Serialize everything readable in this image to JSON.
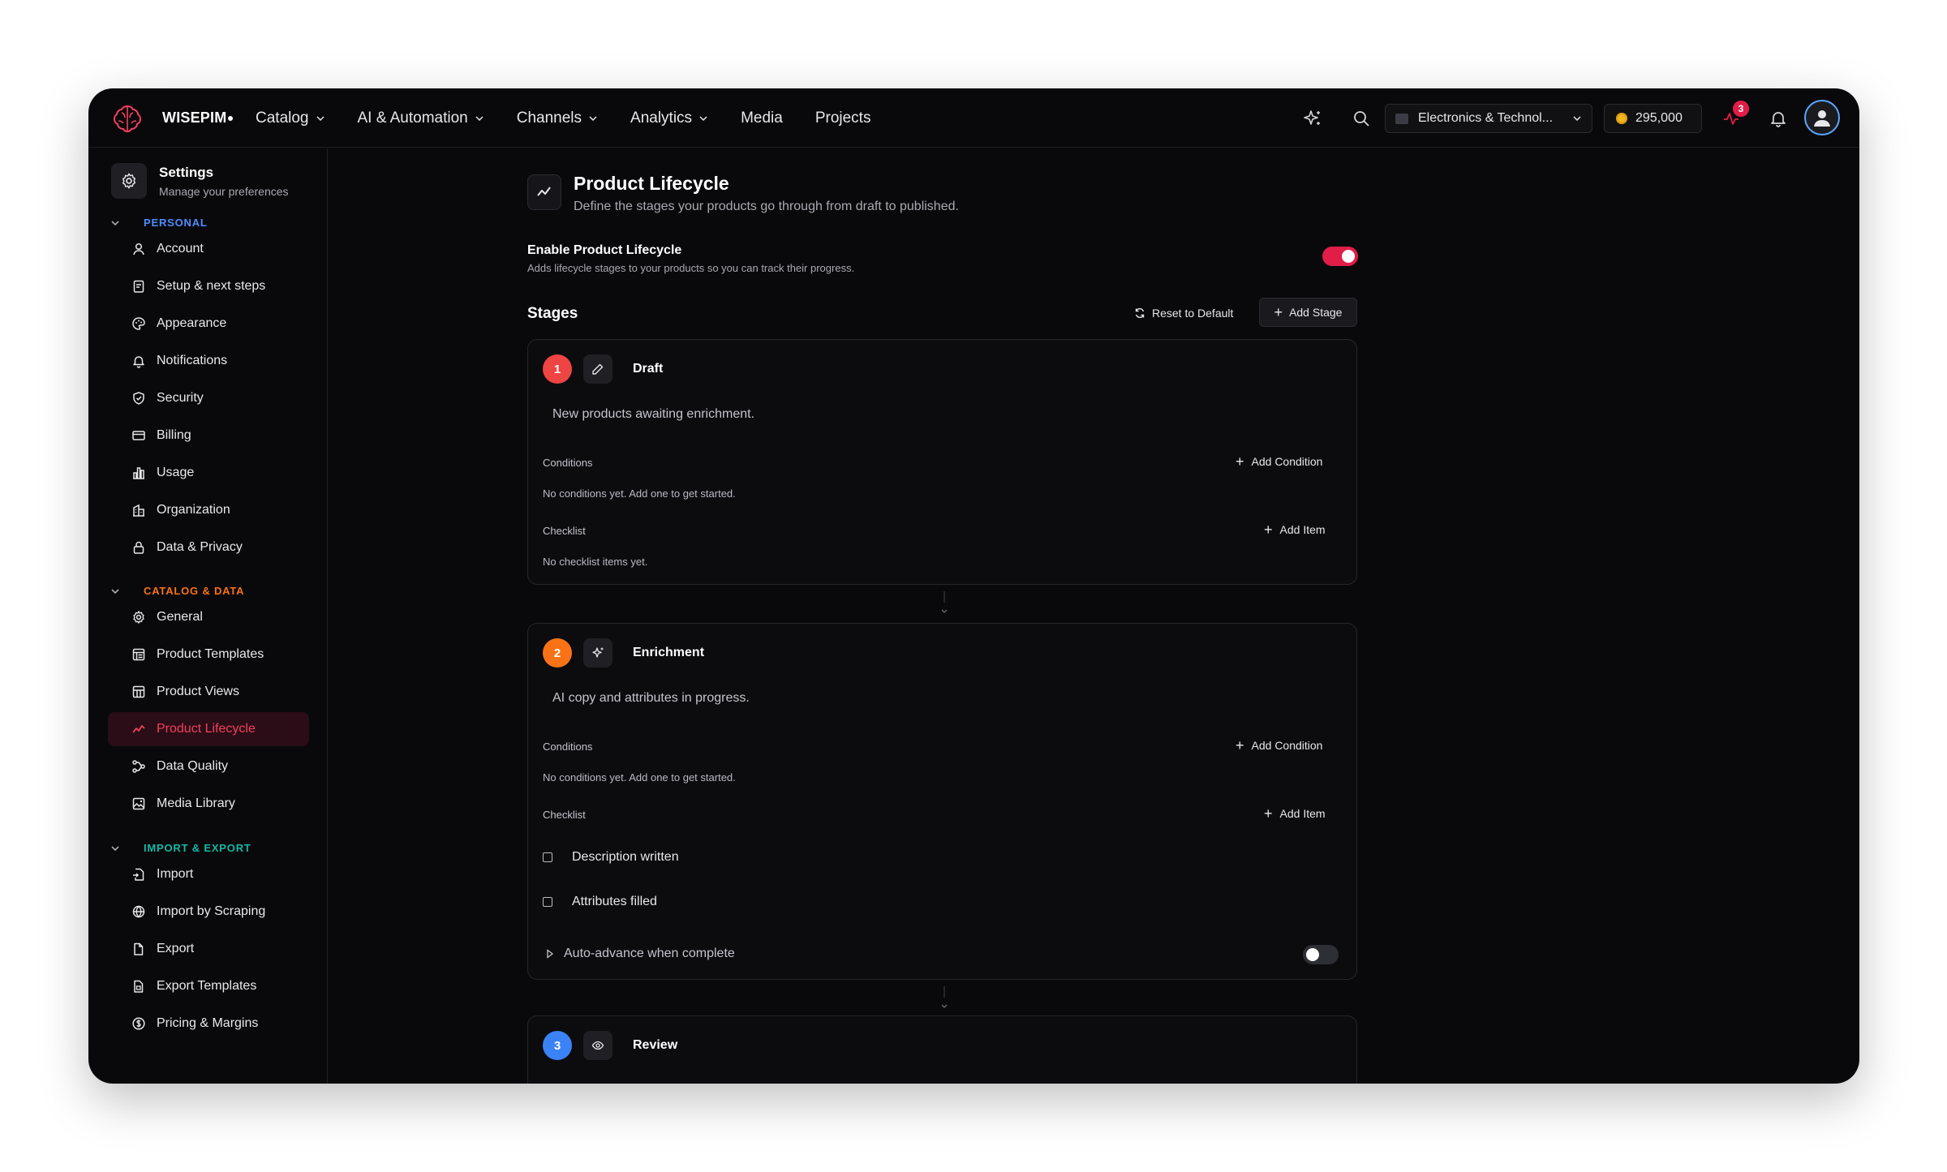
{
  "brand": {
    "name": "WISEPIM"
  },
  "nav": {
    "items": [
      {
        "label": "Catalog",
        "dropdown": true
      },
      {
        "label": "AI & Automation",
        "dropdown": true
      },
      {
        "label": "Channels",
        "dropdown": true
      },
      {
        "label": "Analytics",
        "dropdown": true
      },
      {
        "label": "Media",
        "dropdown": false
      },
      {
        "label": "Projects",
        "dropdown": false
      }
    ]
  },
  "topbar": {
    "org": "Electronics & Technol...",
    "credits": "295,000",
    "notification_badge": "3",
    "icons": [
      "sparkles-icon",
      "search-icon",
      "activity-icon",
      "bell-icon",
      "user-avatar-icon"
    ]
  },
  "sidebar": {
    "title": "Settings",
    "subtitle": "Manage your preferences",
    "sections": [
      {
        "label": "PERSONAL",
        "color": "#4f8cff",
        "items": [
          {
            "label": "Account",
            "icon": "user-icon"
          },
          {
            "label": "Setup & next steps",
            "icon": "clipboard-icon"
          },
          {
            "label": "Appearance",
            "icon": "palette-icon"
          },
          {
            "label": "Notifications",
            "icon": "bell-icon"
          },
          {
            "label": "Security",
            "icon": "shield-icon"
          },
          {
            "label": "Billing",
            "icon": "credit-card-icon"
          },
          {
            "label": "Usage",
            "icon": "bar-chart-icon"
          },
          {
            "label": "Organization",
            "icon": "building-icon"
          },
          {
            "label": "Data & Privacy",
            "icon": "lock-icon"
          }
        ]
      },
      {
        "label": "CATALOG & DATA",
        "color": "#f97316",
        "items": [
          {
            "label": "General",
            "icon": "gear-icon"
          },
          {
            "label": "Product Templates",
            "icon": "template-icon"
          },
          {
            "label": "Product Views",
            "icon": "layout-icon"
          },
          {
            "label": "Product Lifecycle",
            "icon": "activity-icon",
            "active": true
          },
          {
            "label": "Data Quality",
            "icon": "workflow-icon"
          },
          {
            "label": "Media Library",
            "icon": "image-icon"
          }
        ]
      },
      {
        "label": "IMPORT & EXPORT",
        "color": "#14b8a6",
        "items": [
          {
            "label": "Import",
            "icon": "file-import-icon"
          },
          {
            "label": "Import by Scraping",
            "icon": "globe-icon"
          },
          {
            "label": "Export",
            "icon": "file-export-icon"
          },
          {
            "label": "Export Templates",
            "icon": "file-template-icon"
          },
          {
            "label": "Pricing & Margins",
            "icon": "dollar-icon"
          }
        ]
      }
    ]
  },
  "page": {
    "title": "Product Lifecycle",
    "subtitle": "Define the stages your products go through from draft to published.",
    "enable_title": "Enable Product Lifecycle",
    "enable_sub": "Adds lifecycle stages to your products so you can track their progress.",
    "enabled": true,
    "stages_label": "Stages",
    "reset_label": "Reset to Default",
    "add_stage_label": "Add Stage"
  },
  "stages": [
    {
      "number": "1",
      "color": "#ef4444",
      "icon": "pencil-icon",
      "name": "Draft",
      "description": "New products awaiting enrichment.",
      "conditions_label": "Conditions",
      "add_condition_label": "Add Condition",
      "conditions_empty": "No conditions yet. Add one to get started.",
      "checklist_label": "Checklist",
      "add_item_label": "Add Item",
      "checklist_empty": "No checklist items yet."
    },
    {
      "number": "2",
      "color": "#f97316",
      "icon": "sparkles-icon",
      "name": "Enrichment",
      "description": "AI copy and attributes in progress.",
      "conditions_label": "Conditions",
      "add_condition_label": "Add Condition",
      "conditions_empty": "No conditions yet. Add one to get started.",
      "checklist_label": "Checklist",
      "add_item_label": "Add Item",
      "checklist_items": [
        "Description written",
        "Attributes filled"
      ],
      "auto_advance_label": "Auto-advance when complete",
      "auto_advance": false
    },
    {
      "number": "3",
      "color": "#3b82f6",
      "icon": "eye-icon",
      "name": "Review"
    }
  ]
}
